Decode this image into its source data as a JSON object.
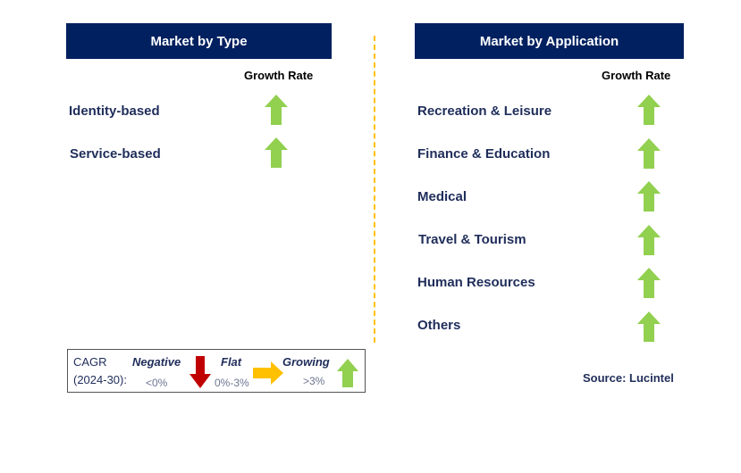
{
  "type_panel": {
    "title": "Market by Type",
    "growth_header": "Growth Rate",
    "items": [
      {
        "label": "Identity-based",
        "trend": "growing"
      },
      {
        "label": "Service-based",
        "trend": "growing"
      }
    ]
  },
  "application_panel": {
    "title": "Market by Application",
    "growth_header": "Growth Rate",
    "items": [
      {
        "label": "Recreation & Leisure",
        "trend": "growing"
      },
      {
        "label": "Finance & Education",
        "trend": "growing"
      },
      {
        "label": "Medical",
        "trend": "growing"
      },
      {
        "label": "Travel & Tourism",
        "trend": "growing"
      },
      {
        "label": "Human Resources",
        "trend": "growing"
      },
      {
        "label": "Others",
        "trend": "growing"
      }
    ]
  },
  "legend": {
    "cagr": "CAGR",
    "period": "(2024-30):",
    "negative": "Negative",
    "negative_range": "<0%",
    "flat": "Flat",
    "flat_range": "0%-3%",
    "growing": "Growing",
    "growing_range": ">3%"
  },
  "source": "Source: Lucintel",
  "colors": {
    "header": "#002060",
    "growing": "#92d050",
    "negative": "#c00000",
    "flat": "#ffc000",
    "divider": "#ffc000"
  }
}
